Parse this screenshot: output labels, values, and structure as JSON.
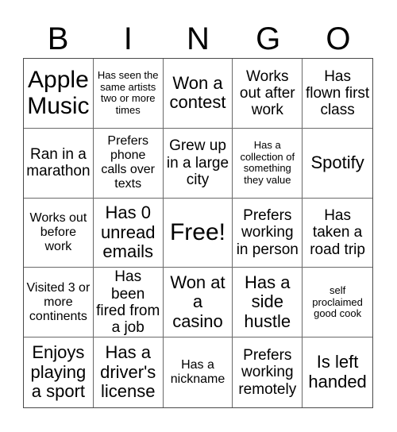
{
  "header": {
    "letters": [
      "B",
      "I",
      "N",
      "G",
      "O"
    ]
  },
  "board": {
    "cells": [
      "Apple Music",
      "Has seen the same artists two or more times",
      "Won a contest",
      "Works out after work",
      "Has flown first class",
      "Ran in a marathon",
      "Prefers phone calls over texts",
      "Grew up in a large city",
      "Has a collection of something they value",
      "Spotify",
      "Works out before work",
      "Has 0 unread emails",
      "Free!",
      "Prefers working in person",
      "Has taken a road trip",
      "Visited 3 or more continents",
      "Has been fired from a job",
      "Won at a casino",
      "Has a side hustle",
      "self proclaimed good cook",
      "Enjoys playing a sport",
      "Has a driver's license",
      "Has a nickname",
      "Prefers working remotely",
      "Is left handed"
    ]
  }
}
